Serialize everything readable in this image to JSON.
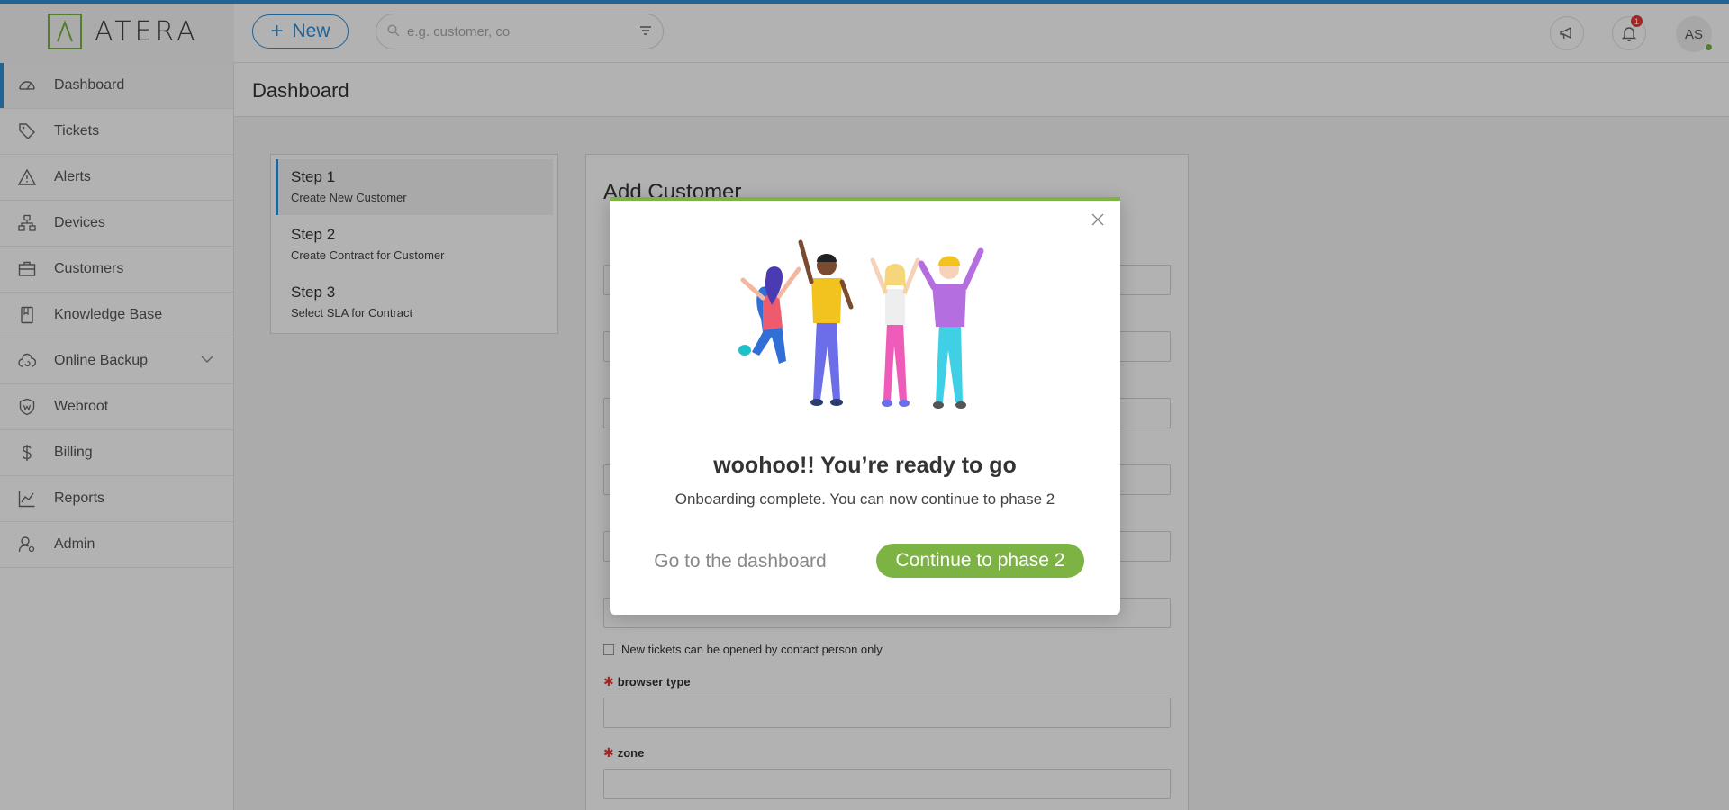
{
  "brand": {
    "name": "ATERA",
    "accent": "#7cb342",
    "primary": "#2f8fd6"
  },
  "topbar": {
    "new_label": "New",
    "search_placeholder": "e.g. customer, co",
    "notification_count": "1",
    "avatar_initials": "AS"
  },
  "sidebar": {
    "items": [
      {
        "label": "Dashboard",
        "icon": "dashboard-icon",
        "active": true
      },
      {
        "label": "Tickets",
        "icon": "tag-icon"
      },
      {
        "label": "Alerts",
        "icon": "alert-icon"
      },
      {
        "label": "Devices",
        "icon": "devices-icon"
      },
      {
        "label": "Customers",
        "icon": "briefcase-icon"
      },
      {
        "label": "Knowledge Base",
        "icon": "book-icon"
      },
      {
        "label": "Online Backup",
        "icon": "cloud-backup-icon",
        "has_submenu": true
      },
      {
        "label": "Webroot",
        "icon": "shield-icon"
      },
      {
        "label": "Billing",
        "icon": "dollar-icon"
      },
      {
        "label": "Reports",
        "icon": "chart-icon"
      },
      {
        "label": "Admin",
        "icon": "admin-icon"
      }
    ]
  },
  "page": {
    "title": "Dashboard"
  },
  "steps": [
    {
      "title": "Step 1",
      "subtitle": "Create New Customer",
      "active": true
    },
    {
      "title": "Step 2",
      "subtitle": "Create Contract for Customer"
    },
    {
      "title": "Step 3",
      "subtitle": "Select SLA for Contract"
    }
  ],
  "form": {
    "title": "Add Customer",
    "checkbox_label": "New tickets can be opened by contact person only",
    "browser_type_label": "browser type",
    "zone_label": "zone"
  },
  "modal": {
    "title": "woohoo!! You’re ready to go",
    "subtitle": "Onboarding complete. You can now continue to phase 2",
    "secondary_label": "Go to the dashboard",
    "primary_label": "Continue to phase 2"
  }
}
